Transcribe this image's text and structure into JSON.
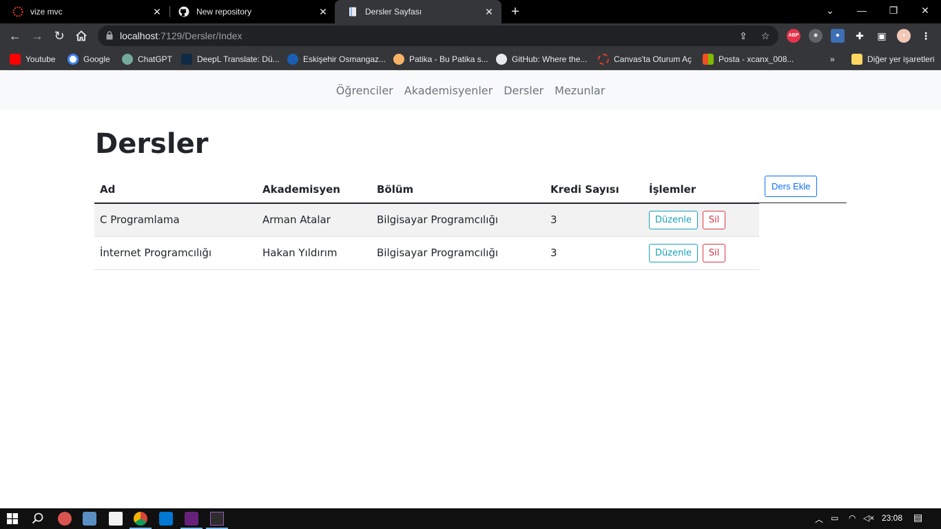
{
  "browser": {
    "tabs": [
      {
        "title": "vize mvc"
      },
      {
        "title": "New repository"
      },
      {
        "title": "Dersler Sayfası"
      }
    ],
    "url_host": "localhost",
    "url_path": ":7129/Dersler/Index",
    "extensions": {
      "abp": "ABP"
    },
    "bookmarks": [
      {
        "label": "Youtube"
      },
      {
        "label": "Google"
      },
      {
        "label": "ChatGPT"
      },
      {
        "label": "DeepL Translate: Dü..."
      },
      {
        "label": "Eskişehir Osmangaz..."
      },
      {
        "label": "Patika - Bu Patika s..."
      },
      {
        "label": "GitHub: Where the..."
      },
      {
        "label": "Canvas'ta Oturum Aç"
      },
      {
        "label": "Posta - xcanx_008..."
      }
    ],
    "other_bookmarks": "Diğer yer işaretleri",
    "more_bookmarks": "»"
  },
  "site": {
    "nav": [
      "Öğrenciler",
      "Akademisyenler",
      "Dersler",
      "Mezunlar"
    ],
    "page_title": "Dersler",
    "table": {
      "headers": [
        "Ad",
        "Akademisyen",
        "Bölüm",
        "Kredi Sayısı",
        "İşlemler"
      ],
      "rows": [
        {
          "ad": "C Programlama",
          "akademisyen": "Arman Atalar",
          "bolum": "Bilgisayar Programcılığı",
          "kredi": "3"
        },
        {
          "ad": "İnternet Programcılığı",
          "akademisyen": "Hakan Yıldırım",
          "bolum": "Bilgisayar Programcılığı",
          "kredi": "3"
        }
      ],
      "edit_label": "Düzenle",
      "delete_label": "Sil",
      "add_label": "Ders Ekle"
    }
  },
  "taskbar": {
    "time": "23:08"
  }
}
